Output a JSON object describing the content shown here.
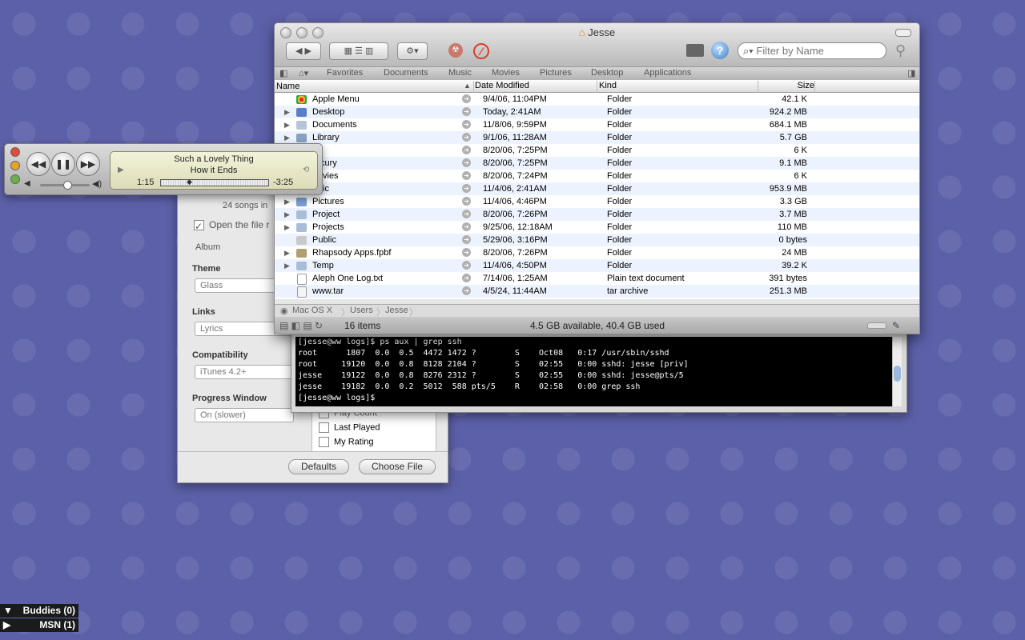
{
  "itunes_prefs": {
    "songs_text": "24 songs in",
    "open_file_label": "Open the file r",
    "album_label": "Album",
    "theme": {
      "label": "Theme",
      "value": "Glass"
    },
    "links": {
      "label": "Links",
      "value": "Lyrics"
    },
    "compatibility": {
      "label": "Compatibility",
      "value": "iTunes 4.2+"
    },
    "progress": {
      "label": "Progress Window",
      "value": "On (slower)"
    },
    "fields": [
      "Play Count",
      "Last Played",
      "My Rating"
    ],
    "defaults_button": "Defaults",
    "choose_file_button": "Choose File"
  },
  "terminal": {
    "lines": [
      "[jesse@ww logs]$ ps aux | grep ssh",
      "root      1807  0.0  0.5  4472 1472 ?        S    Oct08   0:17 /usr/sbin/sshd",
      "root     19120  0.0  0.8  8128 2104 ?        S    02:55   0:00 sshd: jesse [priv]",
      "jesse    19122  0.0  0.8  8276 2312 ?        S    02:55   0:00 sshd: jesse@pts/5",
      "jesse    19182  0.0  0.2  5012  588 pts/5    R    02:58   0:00 grep ssh",
      "[jesse@ww logs]$"
    ]
  },
  "finder": {
    "title": "Jesse",
    "search_placeholder": "Filter by Name",
    "favorites": [
      "Favorites",
      "Documents",
      "Music",
      "Movies",
      "Pictures",
      "Desktop",
      "Applications"
    ],
    "columns": {
      "name": "Name",
      "date": "Date Modified",
      "kind": "Kind",
      "size": "Size"
    },
    "rows": [
      {
        "name": "Apple Menu",
        "date": "9/4/06, 11:04PM",
        "kind": "Folder",
        "size": "42.1 K"
      },
      {
        "name": "Desktop",
        "date": "Today, 2:41AM",
        "kind": "Folder",
        "size": "924.2 MB"
      },
      {
        "name": "Documents",
        "date": "11/8/06, 9:59PM",
        "kind": "Folder",
        "size": "684.1 MB"
      },
      {
        "name": "Library",
        "date": "9/1/06, 11:28AM",
        "kind": "Folder",
        "size": "5.7 GB"
      },
      {
        "name": "",
        "date": "8/20/06, 7:25PM",
        "kind": "Folder",
        "size": "6 K"
      },
      {
        "name": "cury",
        "date": "8/20/06, 7:25PM",
        "kind": "Folder",
        "size": "9.1 MB"
      },
      {
        "name": "vies",
        "date": "8/20/06, 7:24PM",
        "kind": "Folder",
        "size": "6 K"
      },
      {
        "name": "ic",
        "date": "11/4/06, 2:41AM",
        "kind": "Folder",
        "size": "953.9 MB"
      },
      {
        "name": "Pictures",
        "date": "11/4/06, 4:46PM",
        "kind": "Folder",
        "size": "3.3 GB"
      },
      {
        "name": "Project",
        "date": "8/20/06, 7:26PM",
        "kind": "Folder",
        "size": "3.7 MB"
      },
      {
        "name": "Projects",
        "date": "9/25/06, 12:18AM",
        "kind": "Folder",
        "size": "110 MB"
      },
      {
        "name": "Public",
        "date": "5/29/06, 3:16PM",
        "kind": "Folder",
        "size": "0 bytes"
      },
      {
        "name": "Rhapsody Apps.fpbf",
        "date": "8/20/06, 7:26PM",
        "kind": "Folder",
        "size": "24 MB"
      },
      {
        "name": "Temp",
        "date": "11/4/06, 4:50PM",
        "kind": "Folder",
        "size": "39.2 K"
      },
      {
        "name": "Aleph One Log.txt",
        "date": "7/14/06, 1:25AM",
        "kind": "Plain text document",
        "size": "391 bytes"
      },
      {
        "name": "www.tar",
        "date": "4/5/24, 11:44AM",
        "kind": "tar archive",
        "size": "251.3 MB"
      }
    ],
    "path": [
      "Mac OS X",
      "Users",
      "Jesse"
    ],
    "status_items": "16 items",
    "status_space": "4.5 GB available, 40.4 GB used"
  },
  "mini_player": {
    "song": "Such a Lovely Thing",
    "artist": "How it Ends",
    "elapsed": "1:15",
    "remaining": "-3:25",
    "progress": 0.26,
    "volume": 0.55
  },
  "buddy_list": {
    "group1": "Buddies (0)",
    "group2": "MSN (1)"
  }
}
